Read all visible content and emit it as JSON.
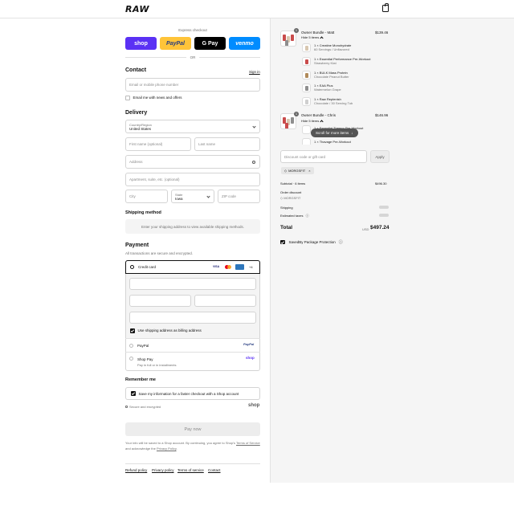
{
  "header": {
    "brand": "RAW"
  },
  "express": {
    "label": "Express checkout",
    "or": "OR",
    "buttons": [
      {
        "label": "shop",
        "color": "#5a31f4"
      },
      {
        "label": "PayPal",
        "color": "#ffc439"
      },
      {
        "label": "G Pay",
        "color": "#000000"
      },
      {
        "label": "venmo",
        "color": "#008cff"
      }
    ]
  },
  "contact": {
    "title": "Contact",
    "sign_in": "Sign in",
    "email_placeholder": "Email or mobile phone number",
    "news_label": "Email me with news and offers"
  },
  "delivery": {
    "title": "Delivery",
    "country_label": "Country/Region",
    "country_value": "United States",
    "first_name": "First name (optional)",
    "last_name": "Last name",
    "address": "Address",
    "apartment": "Apartment, suite, etc. (optional)",
    "city": "City",
    "state_label": "State",
    "state_value": "Iowa",
    "zip": "ZIP code"
  },
  "shipping": {
    "title": "Shipping method",
    "note": "Enter your shipping address to view available shipping methods."
  },
  "payment": {
    "title": "Payment",
    "subtitle": "All transactions are secure and encrypted.",
    "credit_card": "Credit card",
    "billing_same": "Use shipping address as billing address",
    "paypal": "PayPal",
    "shop_pay": "Shop Pay",
    "shop_pay_sub": "Pay in full or in installments",
    "card_more": "+4"
  },
  "remember": {
    "title": "Remember me",
    "save_label": "Save my information for a faster checkout with a Shop account",
    "secure": "Secure and encrypted",
    "shop_logo": "shop"
  },
  "pay_now": "Pay now",
  "legal": {
    "line1": "Your info will be saved to a Shop account. By continuing, you agree to Shop's",
    "tos": "Terms of Service",
    "and": "and acknowledge the",
    "privacy": "Privacy Policy",
    "period": "."
  },
  "footer": [
    "Refund policy",
    "Privacy policy",
    "Terms of service",
    "Contact"
  ],
  "cart": {
    "bundles": [
      {
        "qty": "1",
        "name": "Owner Bundle - Matt",
        "price": "$139.46",
        "hide": "Hide 5 items",
        "items": [
          {
            "title": "1 × Creatine Monohydrate",
            "sub": "60 Servings / Unflavored"
          },
          {
            "title": "1 × Essential Performance Pre-Workout",
            "sub": "Strawberry Kiwi"
          },
          {
            "title": "1 × BULK Mass Protein",
            "sub": "Chocolate Peanut Butter"
          },
          {
            "title": "1 × EAA Plus",
            "sub": "Watermelon Grape"
          },
          {
            "title": "1 × Raw Replenish",
            "sub": "Chocolate / 30 Serving Tub"
          }
        ]
      },
      {
        "qty": "1",
        "name": "Owner Bundle - Chris",
        "price": "$146.96",
        "hide": "Hide 5 items",
        "items": [
          {
            "title": "1 × Essential Thermo Pre-Workout",
            "sub": ""
          },
          {
            "title": "1 × Thavage Pre-Workout",
            "sub": ""
          }
        ]
      }
    ],
    "scroll_hint": "Scroll for more items",
    "discount_placeholder": "Discount code or gift card",
    "apply": "Apply",
    "code_tag": "MORGSFIT",
    "subtotal_label": "Subtotal · 6 items",
    "subtotal_value": "$496.30",
    "order_discount": "Order discount",
    "discount_code": "MORGSFIT",
    "shipping_label": "Shipping",
    "taxes_label": "Estimated taxes",
    "total_label": "Total",
    "currency": "USD",
    "total_value": "$497.24",
    "protection": "SavedBy Package Protection"
  }
}
